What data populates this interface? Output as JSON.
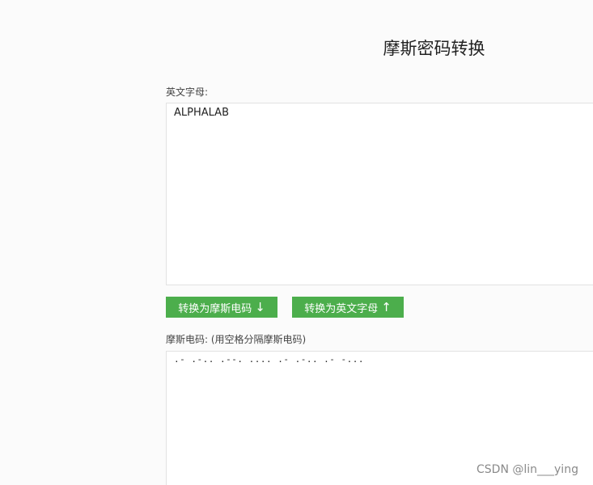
{
  "header": {
    "title": "摩斯密码转换"
  },
  "english": {
    "label": "英文字母:",
    "value": "ALPHALAB"
  },
  "buttons": {
    "to_morse_label": "转换为摩斯电码",
    "to_morse_arrow": "↓",
    "to_english_label": "转换为英文字母",
    "to_english_arrow": "↑",
    "accent_color": "#4cae4c"
  },
  "morse": {
    "label": "摩斯电码: (用空格分隔摩斯电码)",
    "value": ".- .-.. .--. .... .- .-.. .- -..."
  },
  "watermark": {
    "text": "CSDN @lin___ying"
  }
}
